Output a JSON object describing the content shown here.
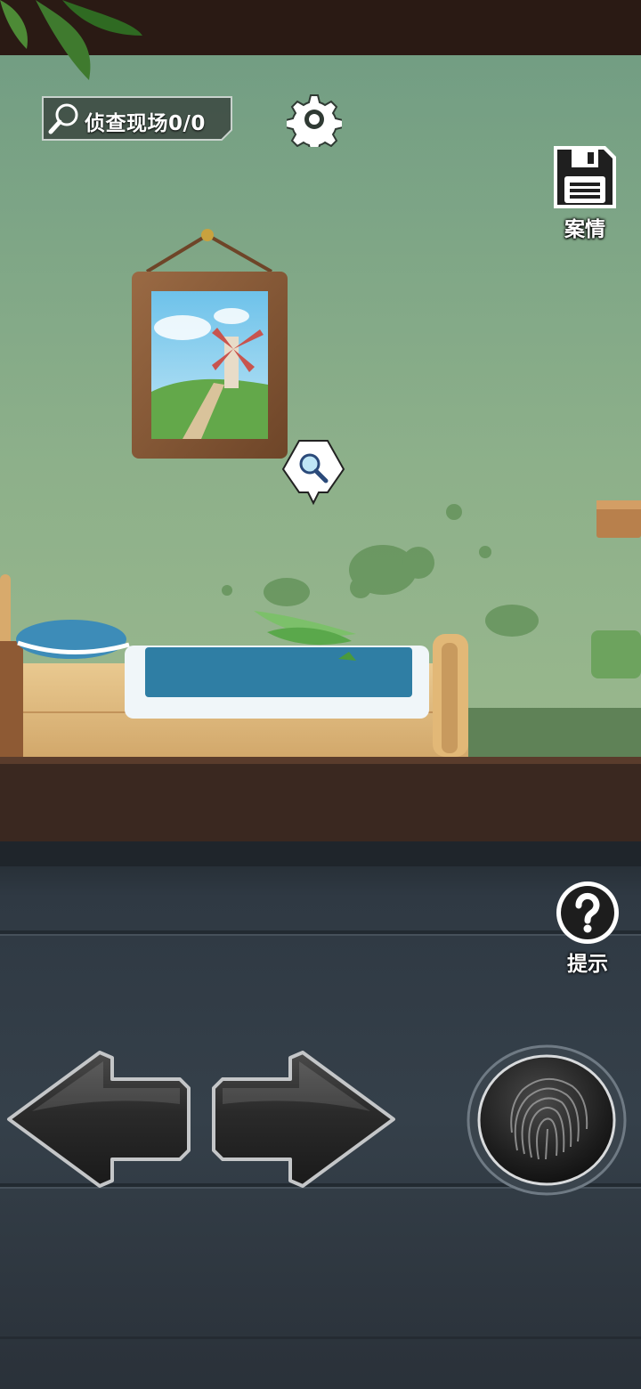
{
  "hud": {
    "scene_label": "侦查现场0/0"
  },
  "buttons": {
    "case_label": "案情",
    "hint_label": "提示"
  },
  "icons": {
    "settings": "gear-icon",
    "case": "floppy-disk-icon",
    "clue": "magnifier-icon",
    "hint": "question-icon",
    "left": "arrow-left-icon",
    "right": "arrow-right-icon",
    "fingerprint": "fingerprint-icon"
  },
  "colors": {
    "wall": "#8fb08a",
    "floor": "#3a2820",
    "panel": "#2e3740",
    "bedsheet": "#2f7ea4"
  }
}
